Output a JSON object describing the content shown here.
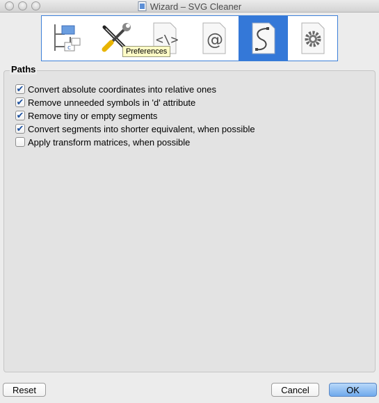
{
  "window": {
    "title": "Wizard – SVG Cleaner"
  },
  "toolbar": {
    "pages": [
      {
        "icon": "tree-structure-icon",
        "selected": false
      },
      {
        "icon": "wrench-screwdriver-icon",
        "selected": false
      },
      {
        "icon": "code-document-icon",
        "selected": false
      },
      {
        "icon": "at-sign-document-icon",
        "selected": false
      },
      {
        "icon": "path-curve-document-icon",
        "selected": true
      },
      {
        "icon": "gear-document-icon",
        "selected": false
      }
    ],
    "tooltip": "Preferences"
  },
  "group": {
    "title": "Paths",
    "options": [
      {
        "label": "Convert absolute coordinates into relative ones",
        "checked": true
      },
      {
        "label": "Remove unneeded symbols in 'd' attribute",
        "checked": true
      },
      {
        "label": "Remove tiny or empty segments",
        "checked": true
      },
      {
        "label": "Convert segments into shorter equivalent, when possible",
        "checked": true
      },
      {
        "label": "Apply transform matrices, when possible",
        "checked": false
      }
    ]
  },
  "buttons": {
    "reset": "Reset",
    "cancel": "Cancel",
    "ok": "OK"
  },
  "colors": {
    "selection": "#3478d8",
    "tooltip_bg": "#fefcc6",
    "ok_button": "#6fa9ec"
  }
}
